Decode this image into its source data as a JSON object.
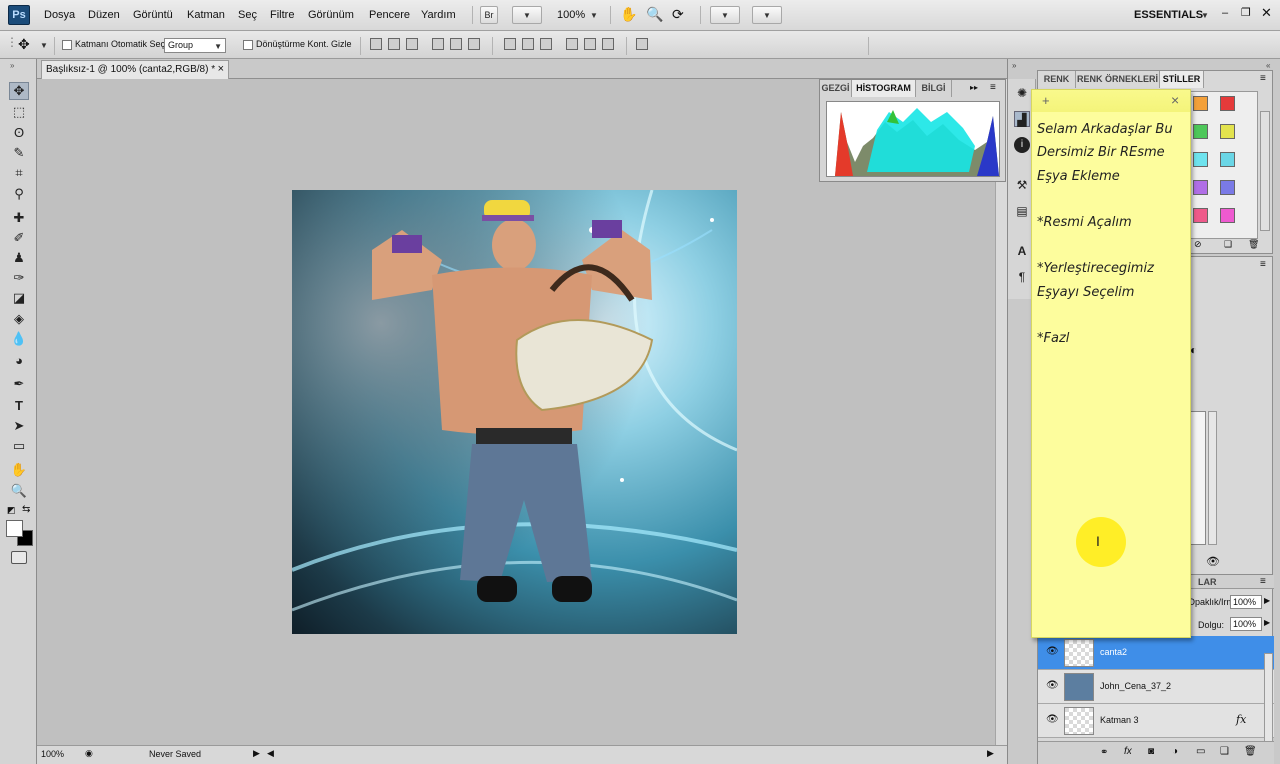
{
  "menubar": {
    "logo": "Ps",
    "items": [
      "Dosya",
      "Düzen",
      "Görüntü",
      "Katman",
      "Seç",
      "Filtre",
      "Görünüm",
      "Pencere",
      "Yardım"
    ],
    "bridge_label": "Br",
    "zoom": "100%",
    "workspace": "ESSENTIALS"
  },
  "options": {
    "auto_select_label": "Katmanı Otomatik Seç:",
    "auto_select_value": "Group",
    "transform_label": "Dönüştürme Kont. Gizle"
  },
  "document": {
    "tab_title": "Başlıksız-1 @ 100% (canta2,RGB/8) *",
    "zoom": "100%",
    "save_state": "Never Saved"
  },
  "histogram": {
    "tabs": [
      "GEZGİ",
      "HİSTOGRAM",
      "BİLGİ"
    ]
  },
  "styles_panel": {
    "tabs": [
      "RENK",
      "RENK ÖRNEKLERİ",
      "STİLLER"
    ],
    "swatch_colors": [
      "#f3a03a",
      "#e53a3a",
      "#4ec75a",
      "#e3e34e",
      "#6ee3ee",
      "#6ad6e6",
      "#b06ee6",
      "#7a7ae6",
      "#ee5a8a",
      "#ee5ad0"
    ]
  },
  "layers": {
    "tab_label": "LAR",
    "opacity_label": "Opaklık/Irmezlik:",
    "opacity_value": "100%",
    "fill_label": "Dolgu:",
    "fill_value": "100%",
    "items": [
      {
        "name": "canta2",
        "selected": true
      },
      {
        "name": "John_Cena_37_2",
        "selected": false
      },
      {
        "name": "Katman 3",
        "selected": false
      }
    ]
  },
  "sticky_note": {
    "add_icon": "+",
    "close_icon": "×",
    "lines": [
      "Selam Arkadaşlar Bu",
      "Dersimiz Bir REsme",
      "Eşya Ekleme",
      "",
      "*Resmi Açalım",
      "",
      "*Yerleştirecegimiz",
      "Eşyayı Seçelim",
      "",
      "*Fazl"
    ]
  }
}
